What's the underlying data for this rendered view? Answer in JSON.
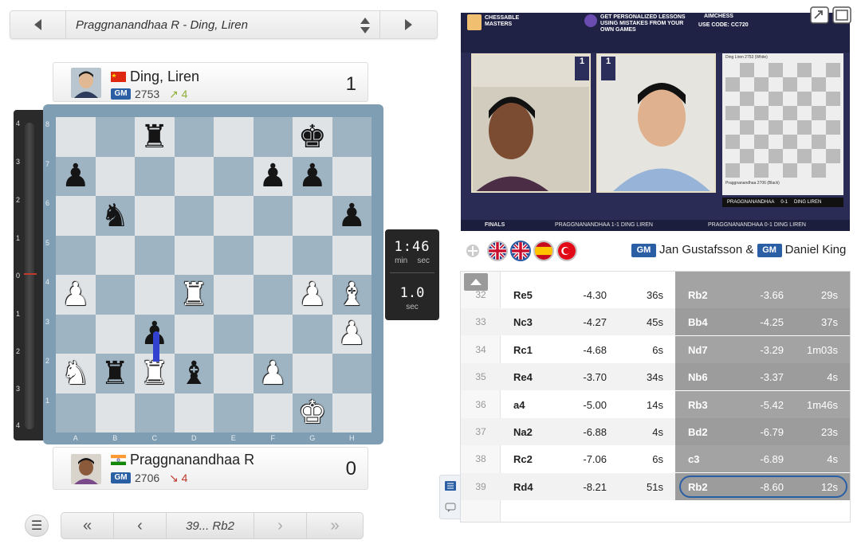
{
  "game_selector": {
    "title": "Praggnanandhaa R - Ding, Liren"
  },
  "top_player": {
    "name": "Ding, Liren",
    "title": "GM",
    "rating": "2753",
    "delta": "↗ 4",
    "score": "1",
    "flag": "China"
  },
  "bottom_player": {
    "name": "Praggnanandhaa R",
    "title": "GM",
    "rating": "2706",
    "delta": "↘ 4",
    "score": "0",
    "flag": "India"
  },
  "eval_bar": {
    "ticks": [
      "4",
      "3",
      "2",
      "1",
      "0",
      "1",
      "2",
      "3",
      "4"
    ],
    "evaluation": -8.6
  },
  "board": {
    "files": [
      "A",
      "B",
      "C",
      "D",
      "E",
      "F",
      "G",
      "H"
    ],
    "ranks": [
      "8",
      "7",
      "6",
      "5",
      "4",
      "3",
      "2",
      "1"
    ],
    "position": [
      [
        "",
        "",
        "br",
        "",
        "",
        "",
        "bk",
        ""
      ],
      [
        "bp",
        "",
        "",
        "",
        "",
        "bp",
        "bp",
        ""
      ],
      [
        "",
        "bn",
        "",
        "",
        "",
        "",
        "",
        "bp"
      ],
      [
        "",
        "",
        "",
        "",
        "",
        "",
        "",
        ""
      ],
      [
        "wp",
        "",
        "",
        "wr",
        "",
        "",
        "wp",
        "wb"
      ],
      [
        "",
        "",
        "bp",
        "",
        "",
        "",
        "",
        "wp"
      ],
      [
        "wn",
        "br",
        "wr",
        "bb",
        "",
        "wp",
        "",
        ""
      ],
      [
        "",
        "",
        "",
        "",
        "",
        "",
        "wk",
        ""
      ]
    ]
  },
  "clock": {
    "time": "1:46",
    "time_labels": [
      "min",
      "sec"
    ],
    "increment": "1.0",
    "increment_label": "sec"
  },
  "nav": {
    "current_move": "39... Rb2"
  },
  "video": {
    "brand": "CHESSABLE MASTERS",
    "promo": "GET PERSONALIZED LESSONS USING MISTAKES FROM YOUR OWN GAMES",
    "sponsor": "AIMCHESS",
    "use_code": "USE CODE: CC720",
    "left_cam_score": "1",
    "right_cam_score": "1",
    "board_top": "Ding Liren 2753 (White)",
    "board_bottom": "Praggnanandhaa 2706 (Black)",
    "result_line": {
      "left": "PRAGGNANANDHAA",
      "score": "0-1",
      "right": "DING LIREN"
    },
    "strip": {
      "stage": "FINALS",
      "match1": "PRAGGNANANDHAA  1-1  DING LIREN",
      "match2": "PRAGGNANANDHAA  0-1  DING LIREN"
    }
  },
  "commentary": {
    "flags": [
      "UK",
      "UK",
      "ES",
      "TR"
    ],
    "gm1_title": "GM",
    "gm1": "Jan Gustafsson",
    "amp": "&",
    "gm2_title": "GM",
    "gm2": "Daniel King"
  },
  "moves": [
    {
      "num": "32",
      "white": "Re5",
      "white_eval": "-4.30",
      "white_time": "36s",
      "black": "Rb2",
      "black_eval": "-3.66",
      "black_time": "29s"
    },
    {
      "num": "33",
      "white": "Nc3",
      "white_eval": "-4.27",
      "white_time": "45s",
      "black": "Bb4",
      "black_eval": "-4.25",
      "black_time": "37s"
    },
    {
      "num": "34",
      "white": "Rc1",
      "white_eval": "-4.68",
      "white_time": "6s",
      "black": "Nd7",
      "black_eval": "-3.29",
      "black_time": "1m03s"
    },
    {
      "num": "35",
      "white": "Re4",
      "white_eval": "-3.70",
      "white_time": "34s",
      "black": "Nb6",
      "black_eval": "-3.37",
      "black_time": "4s"
    },
    {
      "num": "36",
      "white": "a4",
      "white_eval": "-5.00",
      "white_time": "14s",
      "black": "Rb3",
      "black_eval": "-5.42",
      "black_time": "1m46s"
    },
    {
      "num": "37",
      "white": "Na2",
      "white_eval": "-6.88",
      "white_time": "4s",
      "black": "Bd2",
      "black_eval": "-6.79",
      "black_time": "23s"
    },
    {
      "num": "38",
      "white": "Rc2",
      "white_eval": "-7.06",
      "white_time": "6s",
      "black": "c3",
      "black_eval": "-6.89",
      "black_time": "4s"
    },
    {
      "num": "39",
      "white": "Rd4",
      "white_eval": "-8.21",
      "white_time": "51s",
      "black": "Rb2",
      "black_eval": "-8.60",
      "black_time": "12s"
    }
  ],
  "colors": {
    "gm_badge": "#2b5fa5",
    "board_dark": "#9fb4c2",
    "board_light": "#dfe3e6",
    "board_frame": "#7f9eb3",
    "black_move_col": "#a3a3a3",
    "highlight": "#3341d1"
  }
}
